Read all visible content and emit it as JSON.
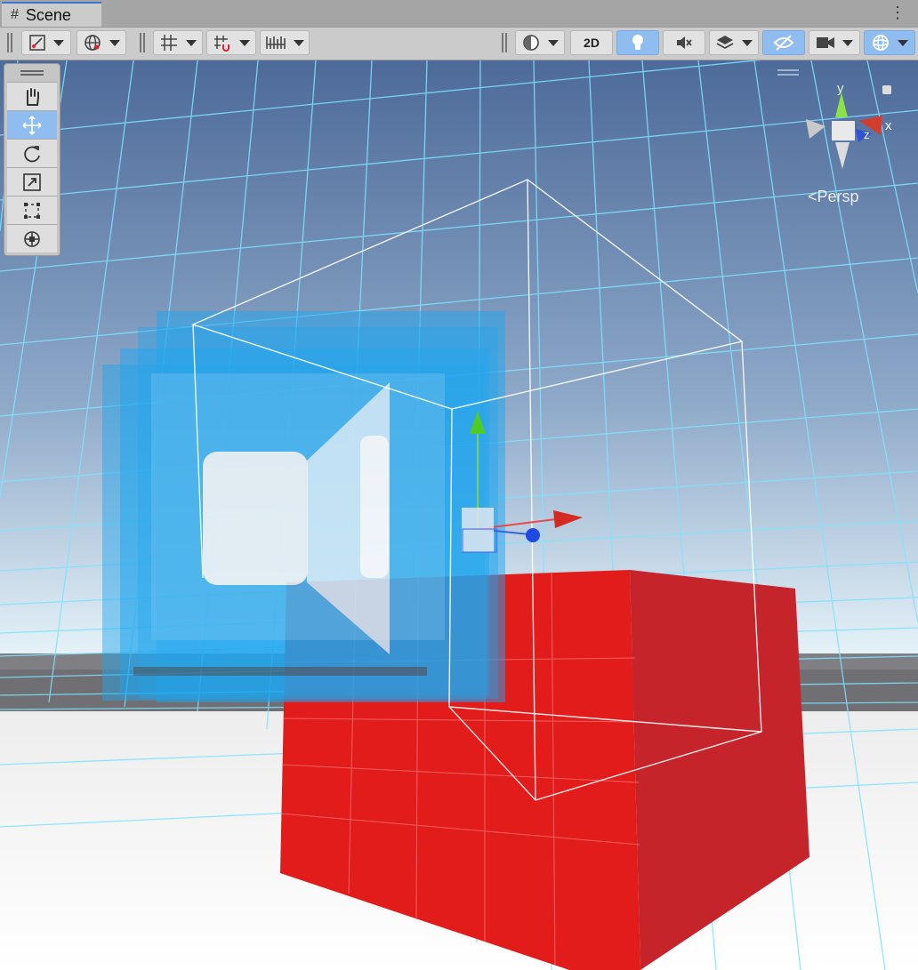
{
  "window": {
    "tab_label": "Scene",
    "tab_icon": "#",
    "menu_glyph": "⋮"
  },
  "toolbar": {
    "btn_2d": "2D",
    "icons": [
      "draw-mode-icon",
      "global-local-icon",
      "grid-snap-icon",
      "increment-snap-icon",
      "ruler-icon",
      "shading-mode-icon",
      "lighting-icon",
      "audio-icon",
      "effects-icon",
      "visibility-icon",
      "camera-icon",
      "gizmos-icon"
    ]
  },
  "tools": {
    "items": [
      "hand-tool",
      "move-tool",
      "rotate-tool",
      "scale-tool",
      "rect-tool",
      "transform-tool"
    ],
    "active": "move-tool"
  },
  "gizmo": {
    "y_label": "y",
    "x_label": "x",
    "z_label": "z",
    "projection": "Persp"
  },
  "colors": {
    "sky_top": "#4d6e9e",
    "sky_bottom": "#dfeef7",
    "cube": "#e21b1b",
    "grid": "#7fe3ff",
    "accent": "#8fbdf0",
    "camera_icon": "#1ea6f0"
  }
}
